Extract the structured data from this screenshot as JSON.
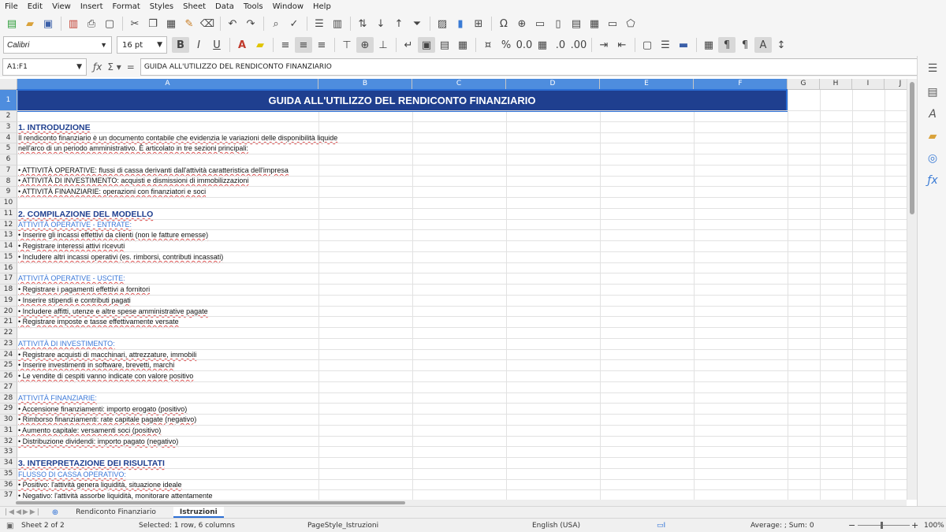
{
  "menu": [
    "File",
    "Edit",
    "View",
    "Insert",
    "Format",
    "Styles",
    "Sheet",
    "Data",
    "Tools",
    "Window",
    "Help"
  ],
  "toolbar": {
    "font_name": "Calibri",
    "font_size": "16 pt",
    "bold": "B",
    "italic": "I",
    "underline": "U"
  },
  "formula": {
    "name_box": "A1:F1",
    "content": "GUIDA ALL'UTILIZZO DEL RENDICONTO FINANZIARIO"
  },
  "columns": [
    "A",
    "B",
    "C",
    "D",
    "E",
    "F",
    "G",
    "H",
    "I",
    "J"
  ],
  "selected_columns": [
    "A",
    "B",
    "C",
    "D",
    "E",
    "F"
  ],
  "rows": [
    "1",
    "2",
    "3",
    "4",
    "5",
    "6",
    "7",
    "8",
    "9",
    "10",
    "11",
    "12",
    "13",
    "14",
    "15",
    "16",
    "17",
    "18",
    "19",
    "20",
    "21",
    "22",
    "23",
    "24",
    "25",
    "26",
    "27",
    "28",
    "29",
    "30",
    "31",
    "32",
    "33",
    "34",
    "35",
    "36",
    "37"
  ],
  "cells": {
    "r1": "GUIDA ALL'UTILIZZO DEL RENDICONTO FINANZIARIO",
    "r3": "1. INTRODUZIONE",
    "r4": "Il rendiconto finanziario è un documento contabile che evidenzia le variazioni delle disponibilità liquide",
    "r5": "nell'arco di un periodo amministrativo. È articolato in tre sezioni principali:",
    "r7": "• ATTIVITÀ OPERATIVE: flussi di cassa derivanti dall'attività caratteristica dell'impresa",
    "r8": "• ATTIVITÀ DI INVESTIMENTO: acquisti e dismissioni di immobilizzazioni",
    "r9": "• ATTIVITÀ FINANZIARIE: operazioni con finanziatori e soci",
    "r11": "2. COMPILAZIONE DEL MODELLO",
    "r12": "ATTIVITÀ OPERATIVE - ENTRATE:",
    "r13": "• Inserire gli incassi effettivi da clienti (non le fatture emesse)",
    "r14": "• Registrare interessi attivi ricevuti",
    "r15": "• Includere altri incassi operativi (es. rimborsi, contributi incassati)",
    "r17": "ATTIVITÀ OPERATIVE - USCITE:",
    "r18": "• Registrare i pagamenti effettivi a fornitori",
    "r19": "• Inserire stipendi e contributi pagati",
    "r20": "• Includere affitti, utenze e altre spese amministrative pagate",
    "r21": "• Registrare imposte e tasse effettivamente versate",
    "r23": "ATTIVITÀ DI INVESTIMENTO:",
    "r24": "• Registrare acquisti di macchinari, attrezzature, immobili",
    "r25": "• Inserire investimenti in software, brevetti, marchi",
    "r26": "• Le vendite di cespiti vanno indicate con valore positivo",
    "r28": "ATTIVITÀ FINANZIARIE:",
    "r29": "• Accensione finanziamenti: importo erogato (positivo)",
    "r30": "• Rimborso finanziamenti: rate capitale pagate (negativo)",
    "r31": "• Aumento capitale: versamenti soci (positivo)",
    "r32": "• Distribuzione dividendi: importo pagato (negativo)",
    "r34": "3. INTERPRETAZIONE DEI RISULTATI",
    "r35": "FLUSSO DI CASSA OPERATIVO:",
    "r36": "• Positivo: l'attività genera liquidità, situazione ideale",
    "r37": "• Negativo: l'attività assorbe liquidità, monitorare attentamente"
  },
  "tabs": [
    "Rendiconto Finanziario",
    "Istruzioni"
  ],
  "active_tab": "Istruzioni",
  "status": {
    "sheet": "Sheet 2 of 2",
    "selection": "Selected: 1 row, 6 columns",
    "page_style": "PageStyle_Istruzioni",
    "language": "English (USA)",
    "summary": "Average: ; Sum: 0",
    "zoom": "100%"
  },
  "colors": {
    "title_bg": "#1f3f8f",
    "heading_text": "#1f3f8f",
    "subheading_text": "#3b78d8",
    "selection": "#4e8dde"
  }
}
